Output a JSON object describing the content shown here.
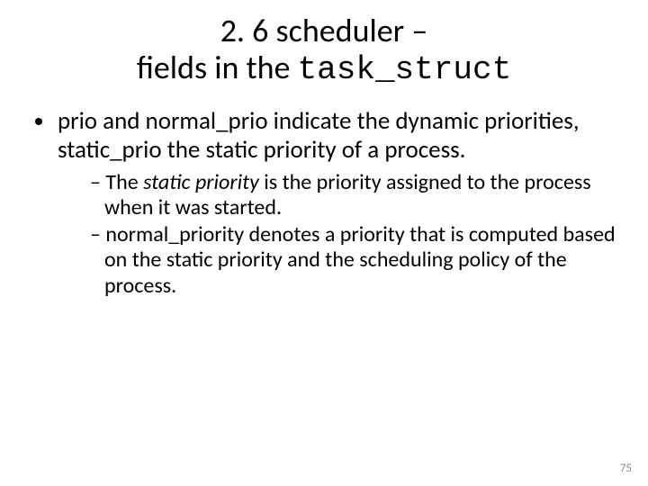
{
  "title_line1": "2. 6 scheduler –",
  "title_line2_prefix": "fields in the ",
  "title_line2_code": "task_struct",
  "bullet1_text": "prio and normal_prio indicate the dynamic priorities, static_prio the static priority of a process.",
  "sub1_a": "The ",
  "sub1_b_italic": "static priority",
  "sub1_c": " is the priority assigned to the process when it was started.",
  "sub2_text": "normal_priority denotes a priority that is computed based on the static priority and the scheduling policy of the process.",
  "page_number": "75"
}
